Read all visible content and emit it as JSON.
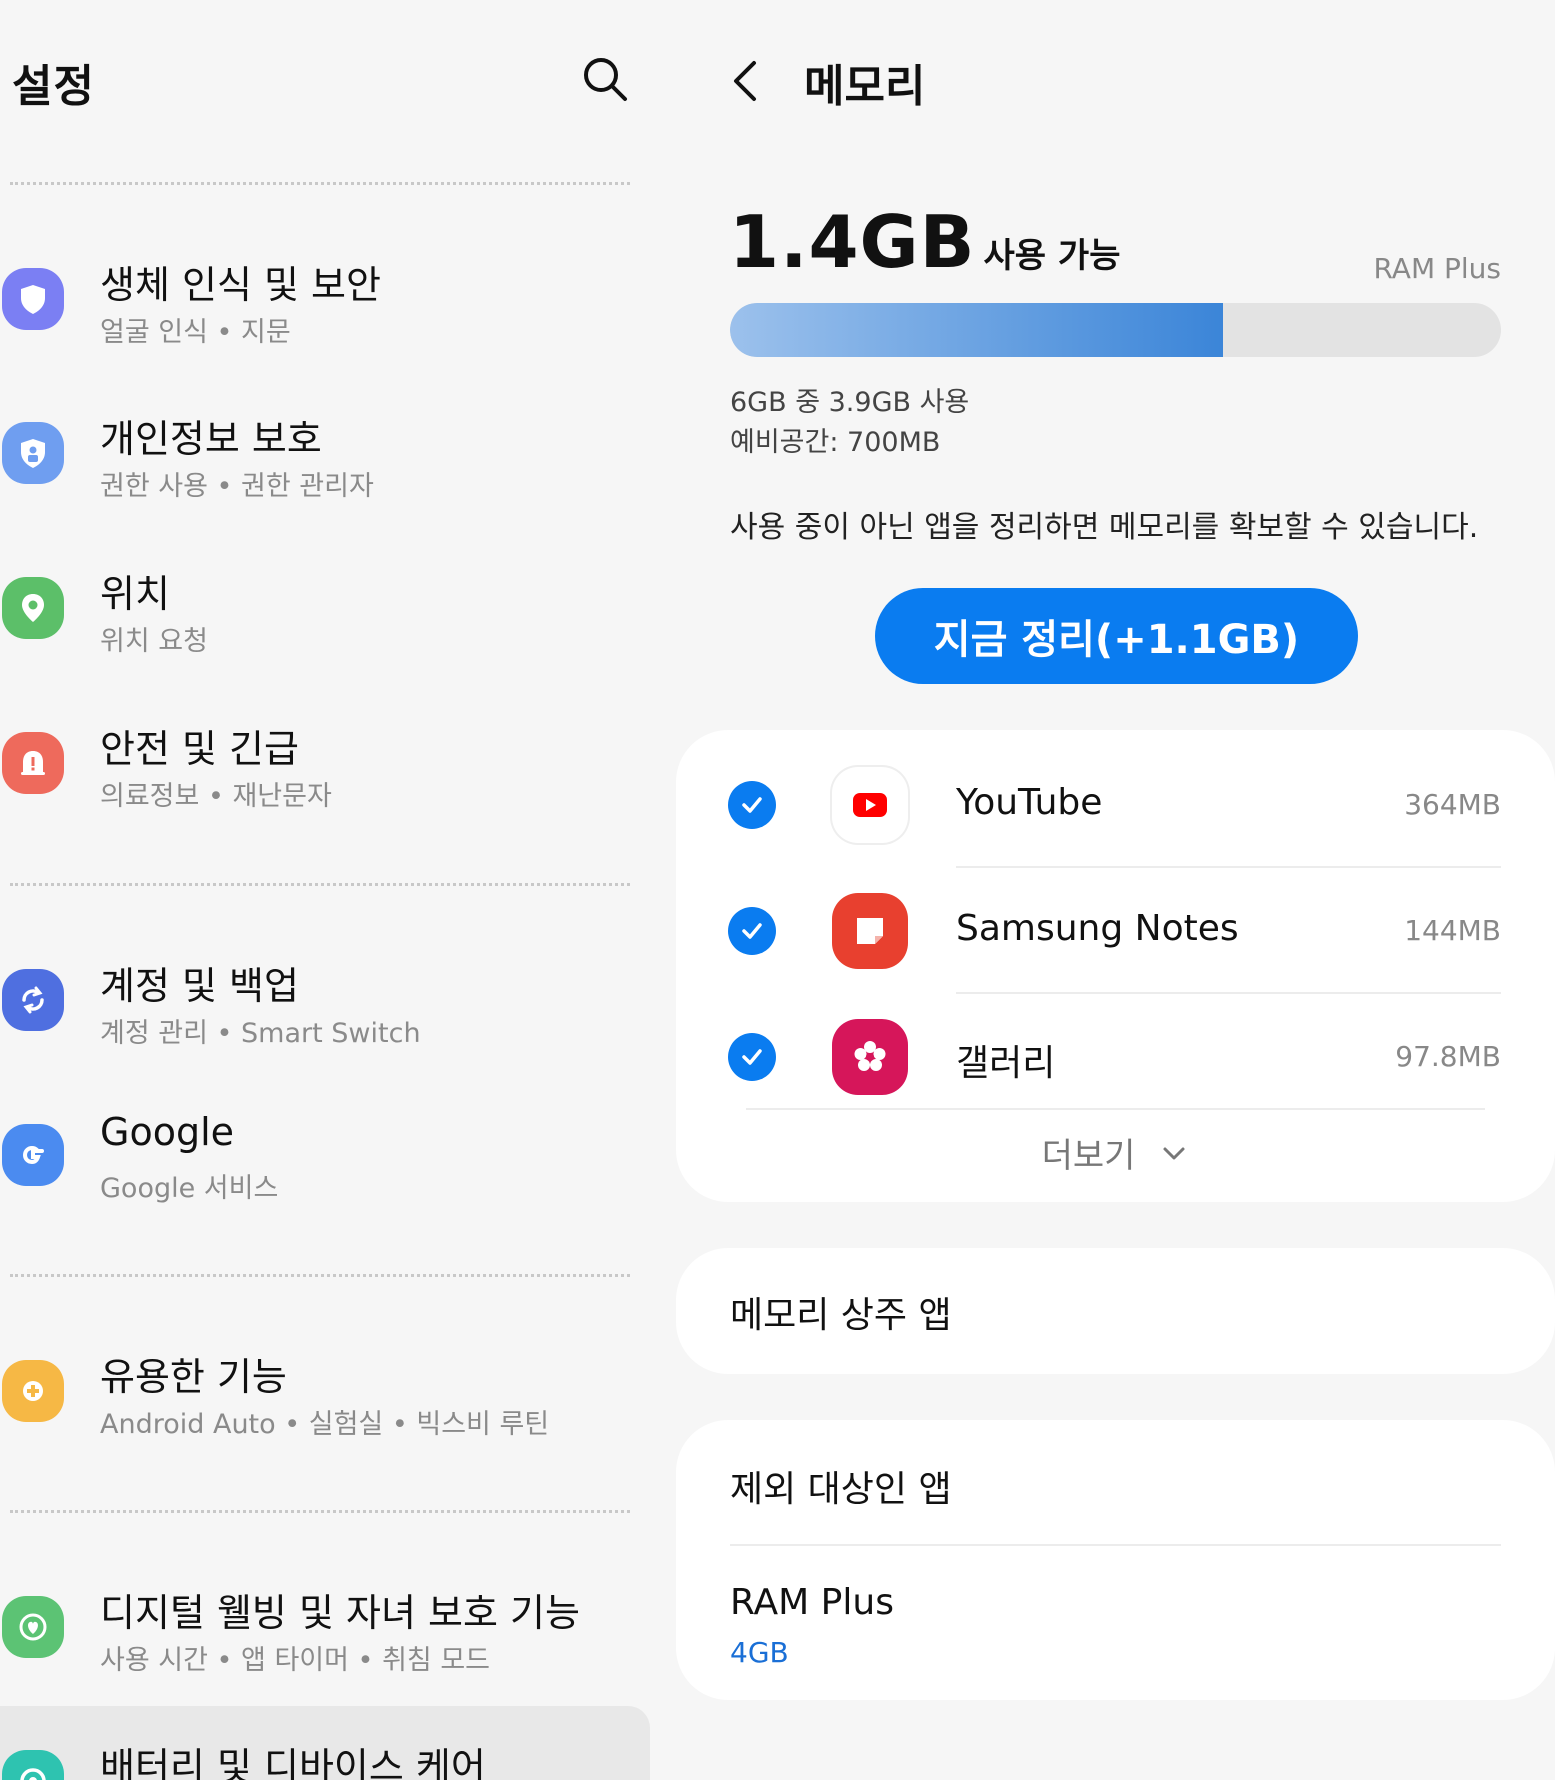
{
  "left": {
    "title": "설정",
    "items": [
      {
        "title": "생체 인식 및 보안",
        "subtitle": "얼굴 인식  •  지문",
        "color": "#7b7ff3",
        "icon": "shield-icon"
      },
      {
        "title": "개인정보 보호",
        "subtitle": "권한 사용  •  권한 관리자",
        "color": "#6f9ef0",
        "icon": "privacy-shield-icon"
      },
      {
        "title": "위치",
        "subtitle": "위치 요청",
        "color": "#5cbf69",
        "icon": "location-pin-icon"
      },
      {
        "title": "안전 및 긴급",
        "subtitle": "의료정보  •  재난문자",
        "color": "#ee6a5c",
        "icon": "emergency-icon"
      },
      {
        "title": "계정 및 백업",
        "subtitle": "계정 관리  •  Smart Switch",
        "color": "#4f6fe0",
        "icon": "sync-icon"
      },
      {
        "title": "Google",
        "subtitle": "Google 서비스",
        "color": "#4b8bf0",
        "icon": "google-icon"
      },
      {
        "title": "유용한 기능",
        "subtitle": "Android Auto  •  실험실  •  빅스비 루틴",
        "color": "#f6b845",
        "icon": "puzzle-icon"
      },
      {
        "title": "디지털 웰빙 및 자녀 보호 기능",
        "subtitle": "사용 시간  •  앱 타이머  •  취침 모드",
        "color": "#5cc374",
        "icon": "wellbeing-heart-icon"
      },
      {
        "title": "배터리 및 디바이스 케어",
        "subtitle": "",
        "color": "#2ec3b0",
        "icon": "device-care-icon"
      }
    ]
  },
  "right": {
    "title": "메모리",
    "available_value": "1.4GB",
    "available_label": "사용 가능",
    "ram_plus_label": "RAM Plus",
    "usage_fraction": 0.64,
    "used_text": "6GB 중 3.9GB 사용",
    "reserve_text": "예비공간: 700MB",
    "hint": "사용 중이 아닌 앱을 정리하면 메모리를 확보할 수 있습니다.",
    "clean_button": "지금 정리(+1.1GB)",
    "apps": [
      {
        "name": "YouTube",
        "size": "364MB",
        "checked": true,
        "icon": "youtube-icon"
      },
      {
        "name": "Samsung Notes",
        "size": "144MB",
        "checked": true,
        "icon": "samsung-notes-icon"
      },
      {
        "name": "갤러리",
        "size": "97.8MB",
        "checked": true,
        "icon": "gallery-icon"
      }
    ],
    "more_label": "더보기",
    "resident_apps": "메모리 상주 앱",
    "excluded_apps": "제외 대상인 앱",
    "ram_plus_title": "RAM Plus",
    "ram_plus_value": "4GB",
    "accent": "#0a7cf0"
  }
}
